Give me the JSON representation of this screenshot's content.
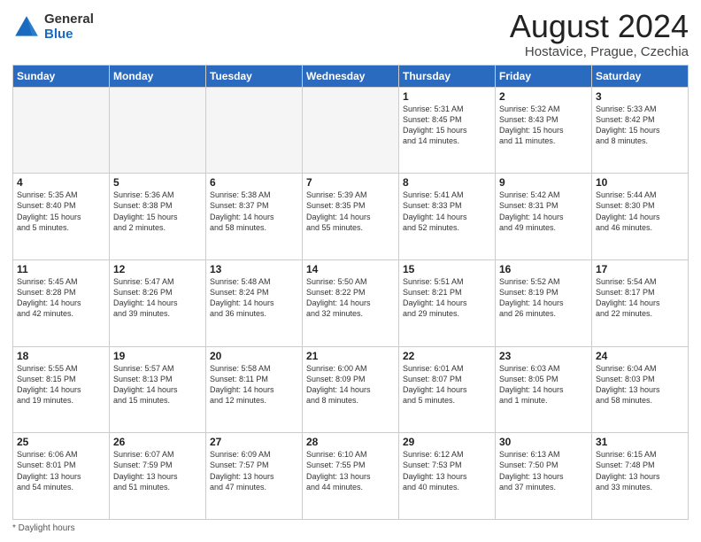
{
  "header": {
    "logo_general": "General",
    "logo_blue": "Blue",
    "month_title": "August 2024",
    "location": "Hostavice, Prague, Czechia"
  },
  "footer": {
    "note": "Daylight hours"
  },
  "days_of_week": [
    "Sunday",
    "Monday",
    "Tuesday",
    "Wednesday",
    "Thursday",
    "Friday",
    "Saturday"
  ],
  "weeks": [
    [
      {
        "day": "",
        "info": ""
      },
      {
        "day": "",
        "info": ""
      },
      {
        "day": "",
        "info": ""
      },
      {
        "day": "",
        "info": ""
      },
      {
        "day": "1",
        "info": "Sunrise: 5:31 AM\nSunset: 8:45 PM\nDaylight: 15 hours\nand 14 minutes."
      },
      {
        "day": "2",
        "info": "Sunrise: 5:32 AM\nSunset: 8:43 PM\nDaylight: 15 hours\nand 11 minutes."
      },
      {
        "day": "3",
        "info": "Sunrise: 5:33 AM\nSunset: 8:42 PM\nDaylight: 15 hours\nand 8 minutes."
      }
    ],
    [
      {
        "day": "4",
        "info": "Sunrise: 5:35 AM\nSunset: 8:40 PM\nDaylight: 15 hours\nand 5 minutes."
      },
      {
        "day": "5",
        "info": "Sunrise: 5:36 AM\nSunset: 8:38 PM\nDaylight: 15 hours\nand 2 minutes."
      },
      {
        "day": "6",
        "info": "Sunrise: 5:38 AM\nSunset: 8:37 PM\nDaylight: 14 hours\nand 58 minutes."
      },
      {
        "day": "7",
        "info": "Sunrise: 5:39 AM\nSunset: 8:35 PM\nDaylight: 14 hours\nand 55 minutes."
      },
      {
        "day": "8",
        "info": "Sunrise: 5:41 AM\nSunset: 8:33 PM\nDaylight: 14 hours\nand 52 minutes."
      },
      {
        "day": "9",
        "info": "Sunrise: 5:42 AM\nSunset: 8:31 PM\nDaylight: 14 hours\nand 49 minutes."
      },
      {
        "day": "10",
        "info": "Sunrise: 5:44 AM\nSunset: 8:30 PM\nDaylight: 14 hours\nand 46 minutes."
      }
    ],
    [
      {
        "day": "11",
        "info": "Sunrise: 5:45 AM\nSunset: 8:28 PM\nDaylight: 14 hours\nand 42 minutes."
      },
      {
        "day": "12",
        "info": "Sunrise: 5:47 AM\nSunset: 8:26 PM\nDaylight: 14 hours\nand 39 minutes."
      },
      {
        "day": "13",
        "info": "Sunrise: 5:48 AM\nSunset: 8:24 PM\nDaylight: 14 hours\nand 36 minutes."
      },
      {
        "day": "14",
        "info": "Sunrise: 5:50 AM\nSunset: 8:22 PM\nDaylight: 14 hours\nand 32 minutes."
      },
      {
        "day": "15",
        "info": "Sunrise: 5:51 AM\nSunset: 8:21 PM\nDaylight: 14 hours\nand 29 minutes."
      },
      {
        "day": "16",
        "info": "Sunrise: 5:52 AM\nSunset: 8:19 PM\nDaylight: 14 hours\nand 26 minutes."
      },
      {
        "day": "17",
        "info": "Sunrise: 5:54 AM\nSunset: 8:17 PM\nDaylight: 14 hours\nand 22 minutes."
      }
    ],
    [
      {
        "day": "18",
        "info": "Sunrise: 5:55 AM\nSunset: 8:15 PM\nDaylight: 14 hours\nand 19 minutes."
      },
      {
        "day": "19",
        "info": "Sunrise: 5:57 AM\nSunset: 8:13 PM\nDaylight: 14 hours\nand 15 minutes."
      },
      {
        "day": "20",
        "info": "Sunrise: 5:58 AM\nSunset: 8:11 PM\nDaylight: 14 hours\nand 12 minutes."
      },
      {
        "day": "21",
        "info": "Sunrise: 6:00 AM\nSunset: 8:09 PM\nDaylight: 14 hours\nand 8 minutes."
      },
      {
        "day": "22",
        "info": "Sunrise: 6:01 AM\nSunset: 8:07 PM\nDaylight: 14 hours\nand 5 minutes."
      },
      {
        "day": "23",
        "info": "Sunrise: 6:03 AM\nSunset: 8:05 PM\nDaylight: 14 hours\nand 1 minute."
      },
      {
        "day": "24",
        "info": "Sunrise: 6:04 AM\nSunset: 8:03 PM\nDaylight: 13 hours\nand 58 minutes."
      }
    ],
    [
      {
        "day": "25",
        "info": "Sunrise: 6:06 AM\nSunset: 8:01 PM\nDaylight: 13 hours\nand 54 minutes."
      },
      {
        "day": "26",
        "info": "Sunrise: 6:07 AM\nSunset: 7:59 PM\nDaylight: 13 hours\nand 51 minutes."
      },
      {
        "day": "27",
        "info": "Sunrise: 6:09 AM\nSunset: 7:57 PM\nDaylight: 13 hours\nand 47 minutes."
      },
      {
        "day": "28",
        "info": "Sunrise: 6:10 AM\nSunset: 7:55 PM\nDaylight: 13 hours\nand 44 minutes."
      },
      {
        "day": "29",
        "info": "Sunrise: 6:12 AM\nSunset: 7:53 PM\nDaylight: 13 hours\nand 40 minutes."
      },
      {
        "day": "30",
        "info": "Sunrise: 6:13 AM\nSunset: 7:50 PM\nDaylight: 13 hours\nand 37 minutes."
      },
      {
        "day": "31",
        "info": "Sunrise: 6:15 AM\nSunset: 7:48 PM\nDaylight: 13 hours\nand 33 minutes."
      }
    ]
  ]
}
